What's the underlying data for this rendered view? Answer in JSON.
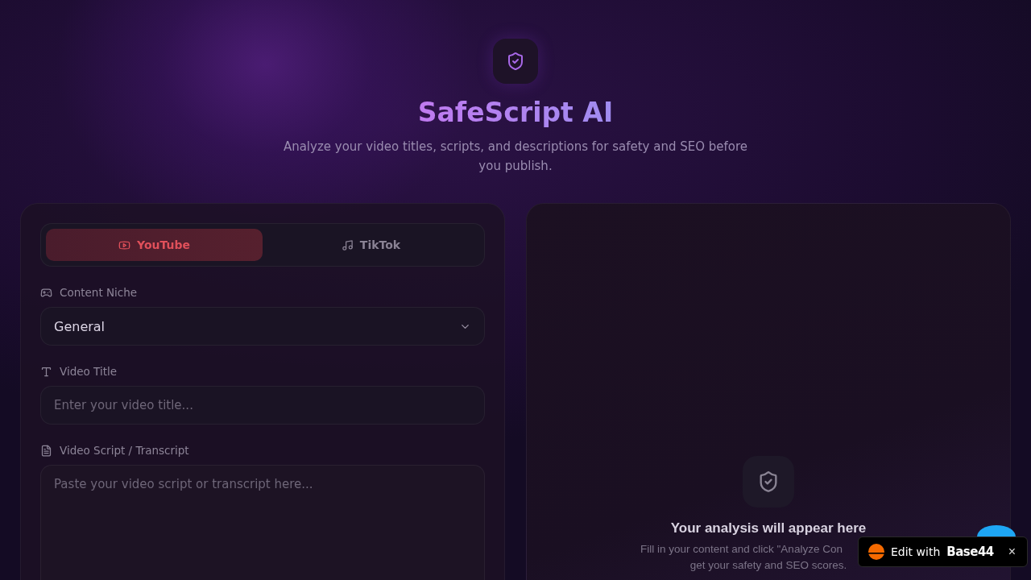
{
  "header": {
    "title": "SafeScript AI",
    "subtitle": "Analyze your video titles, scripts, and descriptions for safety and SEO before you publish."
  },
  "platform_tabs": [
    {
      "label": "YouTube",
      "kind": "youtube",
      "selected": true
    },
    {
      "label": "TikTok",
      "kind": "tiktok",
      "selected": false
    }
  ],
  "fields": [
    {
      "label": "Content Niche",
      "kind": "select",
      "value": "General"
    },
    {
      "label": "Video Title",
      "kind": "input",
      "placeholder": "Enter your video title..."
    },
    {
      "label": "Video Script / Transcript",
      "kind": "textarea",
      "placeholder": "Paste your video script or transcript here..."
    }
  ],
  "results": {
    "title": "Your analysis will appear here",
    "lines": [
      "Fill in your content and click \"Analyze Con",
      "get your safety and SEO scores."
    ]
  },
  "badge": {
    "label": "Edit with",
    "brand": "Base44",
    "close": "×"
  }
}
